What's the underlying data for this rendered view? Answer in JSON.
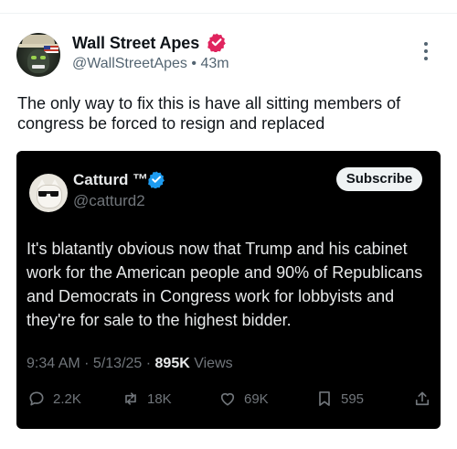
{
  "post": {
    "author_name": "Wall Street Apes",
    "author_handle": "@WallStreetApes",
    "separator": "•",
    "time": "43m",
    "text": "The only way to fix this is have all sitting members of congress be forced to resign and replaced"
  },
  "quoted": {
    "author_name": "Catturd ™",
    "author_handle": "@catturd2",
    "subscribe_label": "Subscribe",
    "text": "It's blatantly obvious now that Trump and his cabinet  work for the American people and 90% of Republicans and Democrats in Congress work for lobbyists and they're for sale to the highest bidder.",
    "time": "9:34 AM",
    "date": "5/13/25",
    "views_count": "895K",
    "views_label": "Views",
    "replies": "2.2K",
    "reposts": "18K",
    "likes": "69K",
    "bookmarks": "595"
  },
  "colors": {
    "verified_badge": "#e0245e",
    "blue_check": "#1d9bf0",
    "quote_bg": "#000000"
  },
  "icons": [
    "verified-badge-icon",
    "more-icon",
    "blue-check-icon",
    "reply-icon",
    "repost-icon",
    "like-icon",
    "bookmark-icon",
    "share-icon"
  ]
}
